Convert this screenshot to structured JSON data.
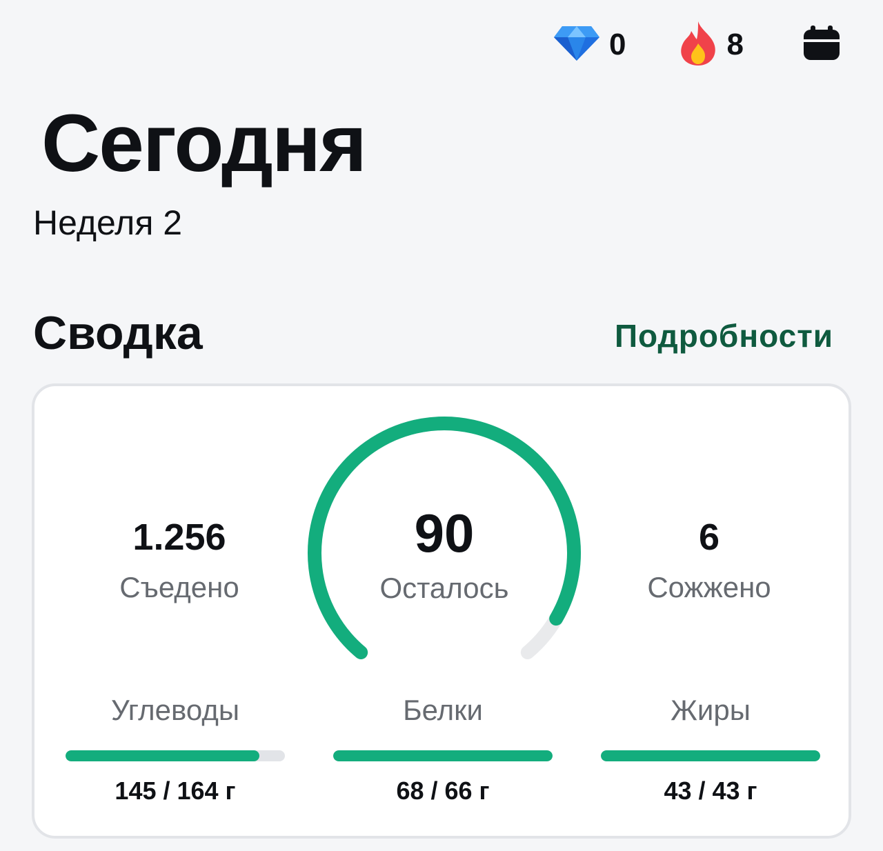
{
  "header": {
    "gems": "0",
    "streak": "8",
    "icons": {
      "gem": "gem-icon",
      "fire": "fire-icon",
      "calendar": "calendar-icon"
    }
  },
  "page": {
    "title": "Сегодня",
    "subtitle": "Неделя 2"
  },
  "summary": {
    "section_title": "Сводка",
    "details_label": "Подробности",
    "eaten": {
      "value": "1.256",
      "label": "Съедено"
    },
    "left": {
      "value": "90",
      "label": "Осталось"
    },
    "burned": {
      "value": "6",
      "label": "Сожжено"
    },
    "calorie_progress": 0.93,
    "macros": [
      {
        "name": "Углеводы",
        "amount": "145 / 164 г",
        "progress": 0.884
      },
      {
        "name": "Белки",
        "amount": "68 / 66 г",
        "progress": 1.0
      },
      {
        "name": "Жиры",
        "amount": "43 / 43 г",
        "progress": 1.0
      }
    ]
  },
  "colors": {
    "accent": "#13ad7d",
    "link": "#0f5a3f",
    "track": "#e2e4e8",
    "background": "#f5f6f8"
  }
}
